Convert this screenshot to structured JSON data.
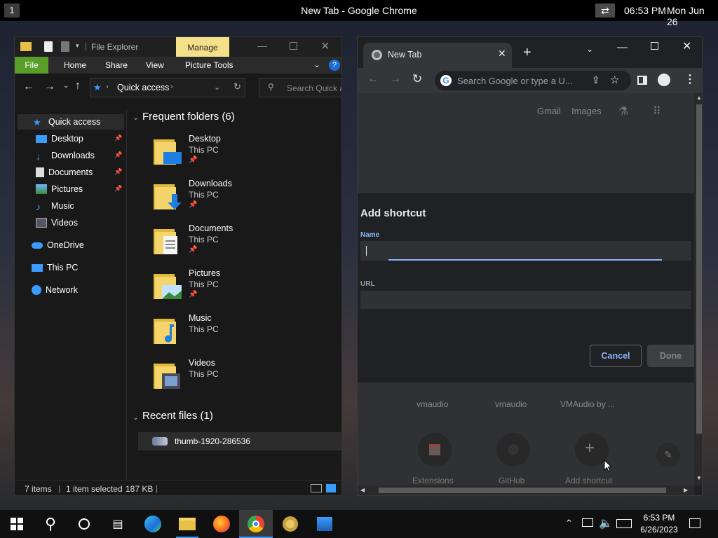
{
  "topbar": {
    "workspace": "1",
    "title": "New Tab - Google Chrome",
    "time": "06:53 PM",
    "date": "Mon Jun 26"
  },
  "explorer": {
    "title": "File Explorer",
    "manage_label": "Manage",
    "ribbon_tabs": [
      "File",
      "Home",
      "Share",
      "View",
      "Picture Tools"
    ],
    "address": "Quick access",
    "search_placeholder": "Search Quick a",
    "sidebar": [
      {
        "label": "Quick access",
        "icon": "star-icon",
        "pinned": false
      },
      {
        "label": "Desktop",
        "icon": "desktop-icon",
        "pinned": true
      },
      {
        "label": "Downloads",
        "icon": "download-icon",
        "pinned": true
      },
      {
        "label": "Documents",
        "icon": "documents-icon",
        "pinned": true
      },
      {
        "label": "Pictures",
        "icon": "pictures-icon",
        "pinned": true
      },
      {
        "label": "Music",
        "icon": "music-icon",
        "pinned": false
      },
      {
        "label": "Videos",
        "icon": "videos-icon",
        "pinned": false
      },
      {
        "label": "OneDrive",
        "icon": "cloud-icon",
        "pinned": false
      },
      {
        "label": "This PC",
        "icon": "computer-icon",
        "pinned": false
      },
      {
        "label": "Network",
        "icon": "network-icon",
        "pinned": false
      }
    ],
    "frequent_header": "Frequent folders (6)",
    "folders": [
      {
        "name": "Desktop",
        "location": "This PC",
        "pinned": true
      },
      {
        "name": "Downloads",
        "location": "This PC",
        "pinned": true
      },
      {
        "name": "Documents",
        "location": "This PC",
        "pinned": true
      },
      {
        "name": "Pictures",
        "location": "This PC",
        "pinned": true
      },
      {
        "name": "Music",
        "location": "This PC",
        "pinned": false
      },
      {
        "name": "Videos",
        "location": "This PC",
        "pinned": false
      }
    ],
    "recent_header": "Recent files (1)",
    "recent_files": [
      "thumb-1920-286536"
    ],
    "status": {
      "items": "7 items",
      "selected": "1 item selected",
      "size": "187 KB"
    }
  },
  "chrome": {
    "tab_title": "New Tab",
    "omnibox_placeholder": "Search Google or type a U...",
    "ntp_links": [
      "Gmail",
      "Images"
    ],
    "dialog": {
      "title": "Add shortcut",
      "name_label": "Name",
      "name_value": "",
      "url_label": "URL",
      "url_value": "",
      "cancel": "Cancel",
      "done": "Done"
    },
    "shortcut_titles": [
      "vmaudio",
      "vmaudio",
      "VMAudio by ..."
    ],
    "shortcuts_row2": [
      "Extensions",
      "GitHub",
      "Add shortcut"
    ]
  },
  "taskbar": {
    "time": "6:53 PM",
    "date": "6/26/2023"
  },
  "colors": {
    "accent": "#8ab4f8",
    "explorer_file_tab": "#5a9e2a",
    "manage_tab": "#f5e08a"
  }
}
